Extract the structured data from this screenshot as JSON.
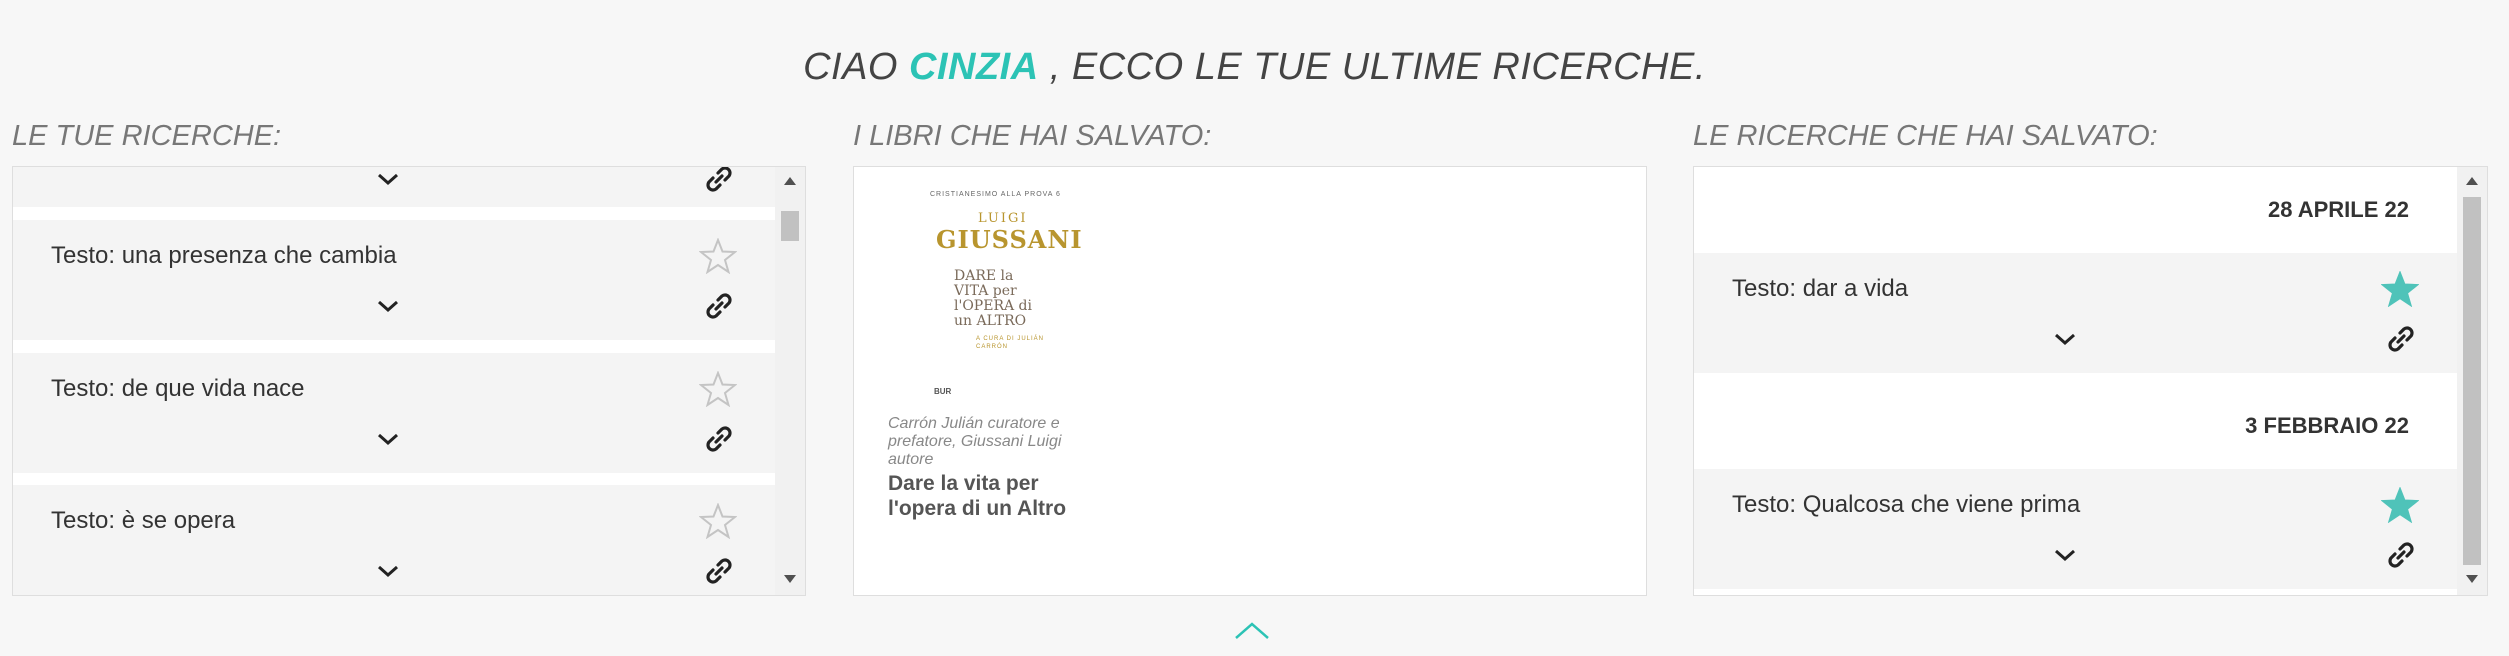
{
  "header": {
    "greeting_prefix": "CIAO",
    "user_name": "CINZIA",
    "greeting_suffix": ", ECCO LE TUE ULTIME RICERCHE."
  },
  "columns": {
    "searches_title": "LE TUE RICERCHE:",
    "books_title": "I LIBRI CHE HAI SALVATO:",
    "saved_searches_title": "LE RICERCHE CHE HAI SALVATO:"
  },
  "searches": [
    {
      "text": "Testo: una presenza che cambia",
      "starred": false
    },
    {
      "text": "Testo: de que vida nace",
      "starred": false
    },
    {
      "text": "Testo: è se opera",
      "starred": false
    }
  ],
  "books": [
    {
      "authors": "Carrón Julián curatore e prefatore, Giussani Luigi autore",
      "title": "Dare la vita per l'opera di un Altro",
      "cover": {
        "series": "CRISTIANESIMO ALLA PROVA 6",
        "author_first": "LUIGI",
        "author_last": "GIUSSANI",
        "title": "DARE la VITA per l'OPERA di un ALTRO",
        "curator": "A CURA DI JULIÁN CARRÓN",
        "publisher_logo": "BUR"
      }
    }
  ],
  "saved_searches": [
    {
      "date": "28 APRILE 22",
      "text": "Testo: dar a vida",
      "starred": true
    },
    {
      "date": "3 FEBBRAIO 22",
      "text": "Testo: Qualcosa che viene prima",
      "starred": true
    }
  ],
  "colors": {
    "accent": "#2cc3b5",
    "star_filled": "#4fc3b9",
    "star_empty": "#c4c4c4",
    "book_gold": "#b8952e"
  },
  "icons": {
    "chevron": "chevron-down-icon",
    "star": "star-icon",
    "link": "link-icon",
    "collapse": "chevron-up-icon"
  }
}
